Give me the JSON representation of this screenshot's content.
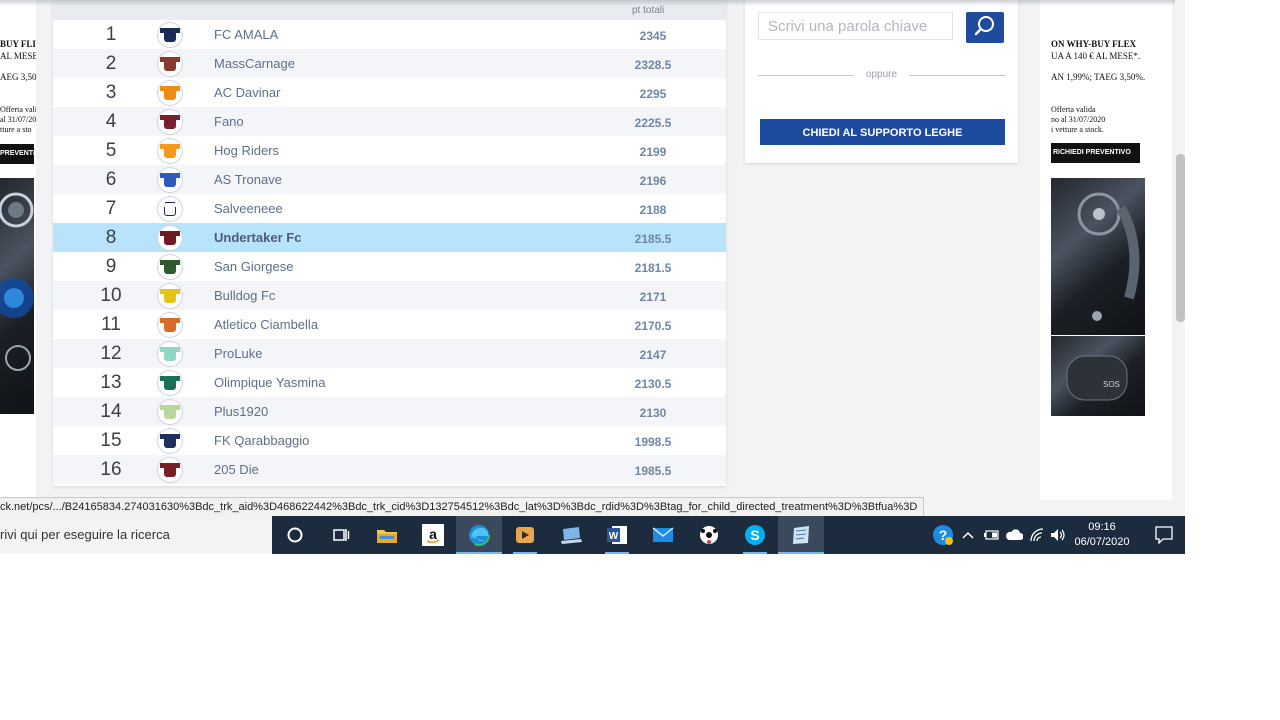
{
  "left_ad": {
    "lines": [
      "BUY FLI",
      "AL MESE",
      "AEG 3,50",
      "Offerta vali",
      "al 31/07/20",
      "tture a sto"
    ],
    "button": "PREVENTIVO"
  },
  "standings": {
    "col_points": "pt totali",
    "rows": [
      {
        "pos": "1",
        "team": "FC AMALA",
        "pts": "2345",
        "shirt": "#1b2a55"
      },
      {
        "pos": "2",
        "team": "MassCarnage",
        "pts": "2328.5",
        "shirt": "#8a3a2c"
      },
      {
        "pos": "3",
        "team": "AC Davinar",
        "pts": "2295",
        "shirt": "#f08a12"
      },
      {
        "pos": "4",
        "team": "Fano",
        "pts": "2225.5",
        "shirt": "#7a1f2e"
      },
      {
        "pos": "5",
        "team": "Hog Riders",
        "pts": "2199",
        "shirt": "#f59a1e"
      },
      {
        "pos": "6",
        "team": "AS Tronave",
        "pts": "2196",
        "shirt": "#2d5bb5"
      },
      {
        "pos": "7",
        "team": "Salveeneee",
        "pts": "2188",
        "shirt": "#ffffff"
      },
      {
        "pos": "8",
        "team": "Undertaker Fc",
        "pts": "2185.5",
        "shirt": "#6d1a24"
      },
      {
        "pos": "9",
        "team": "San Giorgese",
        "pts": "2181.5",
        "shirt": "#2f5a2e"
      },
      {
        "pos": "10",
        "team": "Bulldog Fc",
        "pts": "2171",
        "shirt": "#e6c317"
      },
      {
        "pos": "11",
        "team": "Atletico Ciambella",
        "pts": "2170.5",
        "shirt": "#d96a2b"
      },
      {
        "pos": "12",
        "team": "ProLuke",
        "pts": "2147",
        "shirt": "#8fd6c5"
      },
      {
        "pos": "13",
        "team": "Olimpique Yasmina",
        "pts": "2130.5",
        "shirt": "#1b6e5a"
      },
      {
        "pos": "14",
        "team": "Plus1920",
        "pts": "2130",
        "shirt": "#b8d79a"
      },
      {
        "pos": "15",
        "team": "FK Qarabbaggio",
        "pts": "1998.5",
        "shirt": "#1d2f5e"
      },
      {
        "pos": "16",
        "team": "205 Die",
        "pts": "1985.5",
        "shirt": "#7a1e26"
      }
    ],
    "highlight_color": "#b7e3fb"
  },
  "sidebar": {
    "search_placeholder": "Scrivi una parola chiave",
    "or_label": "oppure",
    "support_button": "CHIEDI AL SUPPORTO LEGHE",
    "accent": "#1f4b9e"
  },
  "right_ad": {
    "line1": "ON WHY-BUY FLEX",
    "line2": "UA A 140 € AL MESE*.",
    "line3": "AN 1,99%; TAEG 3,50%.",
    "line4": "Offerta valida",
    "line5": "no al 31/07/2020",
    "line6": "i vetture a stock.",
    "button": "RICHIEDI PREVENTIVO",
    "sos": "SOS"
  },
  "status_url": "ck.net/pcs/.../B24165834.274031630%3Bdc_trk_aid%3D468622442%3Bdc_trk_cid%3D132754512%3Bdc_lat%3D%3Bdc_rdid%3D%3Btag_for_child_directed_treatment%3D%3Btfua%3D",
  "taskbar": {
    "search_text": "rivi qui per eseguire la ricerca",
    "time": "09:16",
    "date": "06/07/2020"
  }
}
